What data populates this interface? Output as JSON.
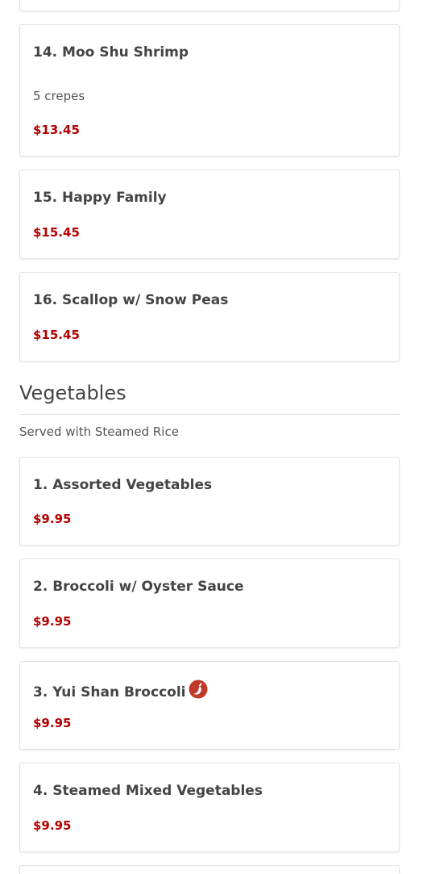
{
  "colors": {
    "price": "#b30000",
    "text": "#444444",
    "card_border": "#e3e3e3"
  },
  "items_top": [
    {
      "name": "14. Moo Shu Shrimp",
      "desc": "5 crepes",
      "price": "$13.45"
    },
    {
      "name": "15. Happy Family",
      "price": "$15.45"
    },
    {
      "name": "16. Scallop w/ Snow Peas",
      "price": "$15.45"
    }
  ],
  "vegetables": {
    "title": "Vegetables",
    "subtitle": "Served with Steamed Rice",
    "items": [
      {
        "name": "1. Assorted Vegetables",
        "price": "$9.95"
      },
      {
        "name": "2. Broccoli w/ Oyster Sauce",
        "price": "$9.95"
      },
      {
        "name": "3. Yui Shan Broccoli",
        "price": "$9.95",
        "icon": "spicy-pepper-icon"
      },
      {
        "name": "4. Steamed Mixed Vegetables",
        "price": "$9.95"
      }
    ]
  }
}
